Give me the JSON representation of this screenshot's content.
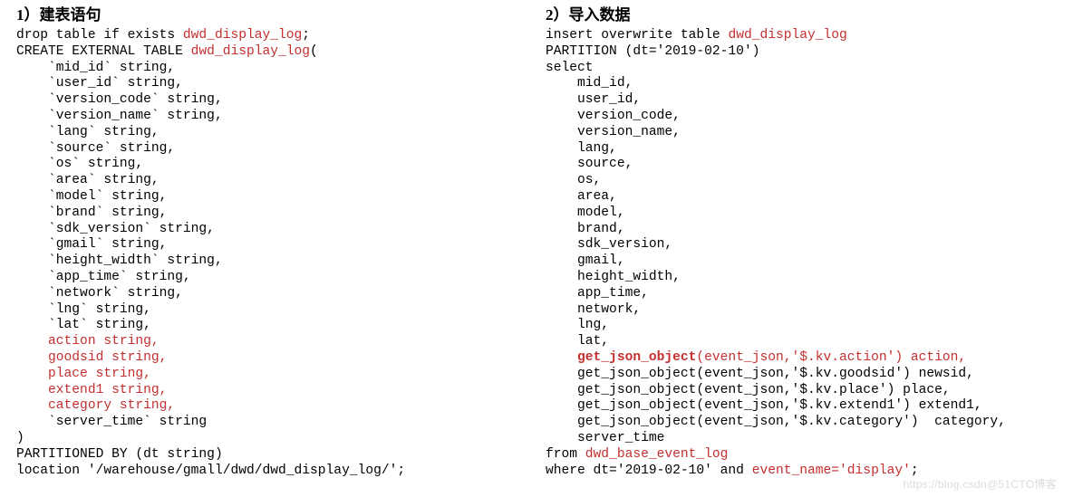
{
  "left": {
    "title": "1）建表语句",
    "ln00a": "drop table if exists ",
    "ln00b": "dwd_display_log",
    "ln00c": ";",
    "ln01a": "CREATE EXTERNAL TABLE ",
    "ln01b": "dwd_display_log",
    "ln01c": "(",
    "ln02": "    `mid_id` string,",
    "ln03": "    `user_id` string,",
    "ln04": "    `version_code` string,",
    "ln05": "    `version_name` string,",
    "ln06": "    `lang` string,",
    "ln07": "    `source` string,",
    "ln08": "    `os` string,",
    "ln09": "    `area` string,",
    "ln10": "    `model` string,",
    "ln11": "    `brand` string,",
    "ln12": "    `sdk_version` string,",
    "ln13": "    `gmail` string,",
    "ln14": "    `height_width` string,",
    "ln15": "    `app_time` string,",
    "ln16": "    `network` string,",
    "ln17": "    `lng` string,",
    "ln18": "    `lat` string,",
    "ln19": "    action string,",
    "ln20": "    goodsid string,",
    "ln21": "    place string,",
    "ln22": "    extend1 string,",
    "ln23": "    category string,",
    "ln24": "    `server_time` string",
    "ln25": ")",
    "ln26": "PARTITIONED BY (dt string)",
    "ln27": "location '/warehouse/gmall/dwd/dwd_display_log/';"
  },
  "right": {
    "title": "2）导入数据",
    "ln00a": "insert overwrite table ",
    "ln00b": "dwd_display_log",
    "ln01": "PARTITION (dt='2019-02-10')",
    "ln02": "select",
    "ln03": "    mid_id,",
    "ln04": "    user_id,",
    "ln05": "    version_code,",
    "ln06": "    version_name,",
    "ln07": "    lang,",
    "ln08": "    source,",
    "ln09": "    os,",
    "ln10": "    area,",
    "ln11": "    model,",
    "ln12": "    brand,",
    "ln13": "    sdk_version,",
    "ln14": "    gmail,",
    "ln15": "    height_width,",
    "ln16": "    app_time,",
    "ln17": "    network,",
    "ln18": "    lng,",
    "ln19": "    lat,",
    "ln20pad": "    ",
    "ln20bold": "get_json_object",
    "ln20rest": "(event_json,'$.kv.action') action,",
    "ln21": "    get_json_object(event_json,'$.kv.goodsid') newsid,",
    "ln22": "    get_json_object(event_json,'$.kv.place') place,",
    "ln23": "    get_json_object(event_json,'$.kv.extend1') extend1,",
    "ln24": "    get_json_object(event_json,'$.kv.category')  category,",
    "ln25": "    server_time",
    "ln26a": "from ",
    "ln26b": "dwd_base_event_log",
    "ln27a": "where dt='2019-02-10' and ",
    "ln27b": "event_name='display'",
    "ln27c": ";"
  },
  "watermark": "https://blog.csdn@51CTO博客"
}
